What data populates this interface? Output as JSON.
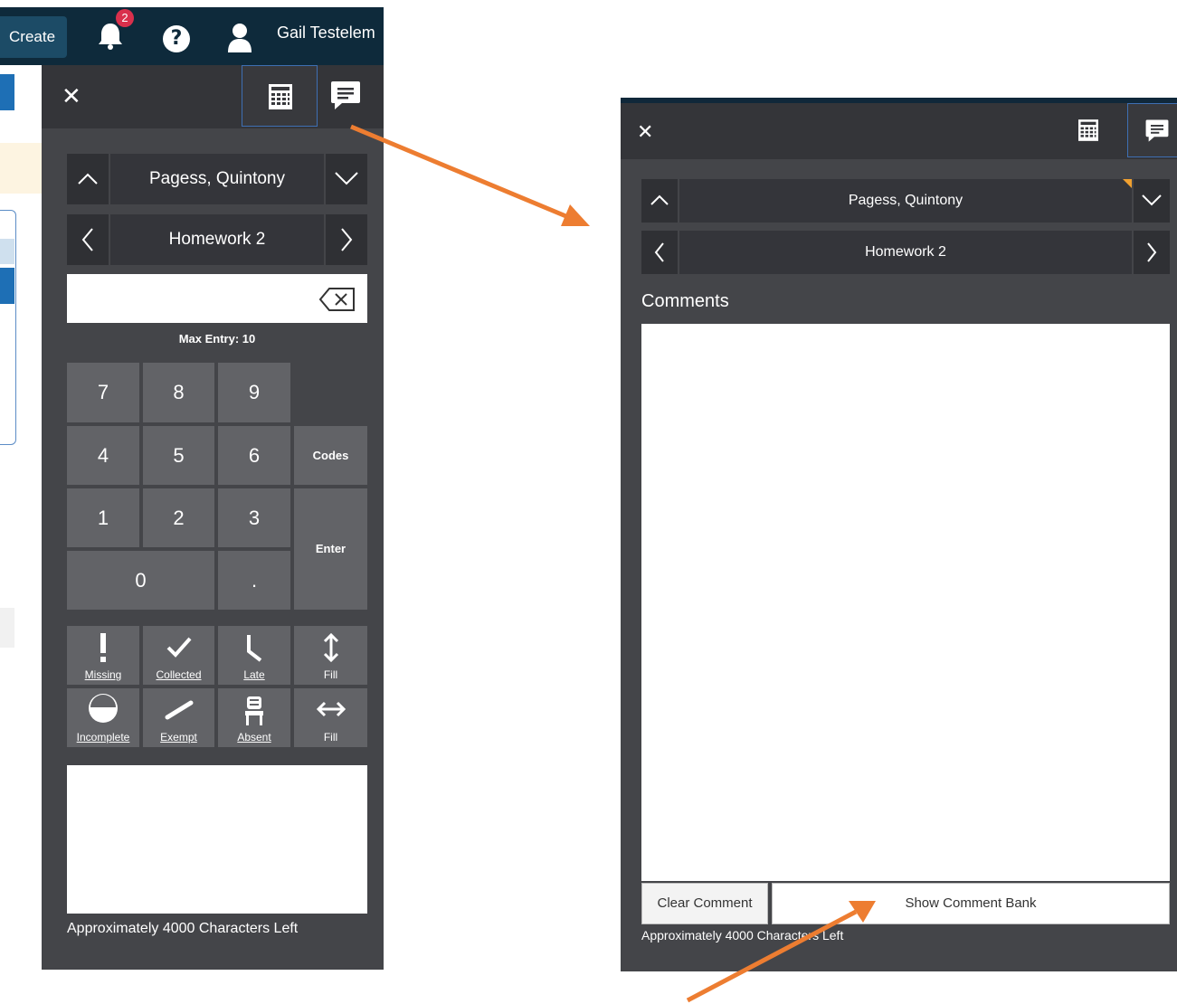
{
  "topbar": {
    "create_label": "Create",
    "notification_count": "2",
    "user_name": "Gail Testelem"
  },
  "left_panel": {
    "student": "Pagess, Quintony",
    "assignment": "Homework 2",
    "max_entry": "Max Entry: 10",
    "keys": [
      "7",
      "8",
      "9",
      "4",
      "5",
      "6",
      "1",
      "2",
      "3",
      "0",
      "."
    ],
    "codes_label": "Codes",
    "enter_label": "Enter",
    "flags": {
      "missing": "Missing",
      "collected": "Collected",
      "late": "Late",
      "fill_vertical": "Fill",
      "incomplete": "Incomplete",
      "exempt": "Exempt",
      "absent": "Absent",
      "fill_horizontal": "Fill"
    },
    "chars_left": "Approximately 4000 Characters Left"
  },
  "right_panel": {
    "student": "Pagess, Quintony",
    "assignment": "Homework 2",
    "comments_title": "Comments",
    "clear_comment": "Clear Comment",
    "show_comment_bank": "Show Comment Bank",
    "chars_left": "Approximately 4000 Characters Left"
  },
  "colors": {
    "topbar": "#0e2a3b",
    "panel": "#444549",
    "panel_header": "#343539",
    "key": "#626367",
    "annotation_arrow": "#ed7d31",
    "flag_marker": "#f0a030",
    "active_tab_border": "#3e6fb3"
  },
  "icons": [
    "bell-icon",
    "help-icon",
    "user-icon",
    "close-icon",
    "calculator-icon",
    "comment-icon",
    "chevron-up-icon",
    "chevron-down-icon",
    "chevron-left-icon",
    "chevron-right-icon",
    "backspace-icon",
    "exclamation-icon",
    "checkmark-icon",
    "late-icon",
    "vertical-arrows-icon",
    "half-circle-icon",
    "slash-icon",
    "chair-icon",
    "horizontal-arrows-icon"
  ]
}
